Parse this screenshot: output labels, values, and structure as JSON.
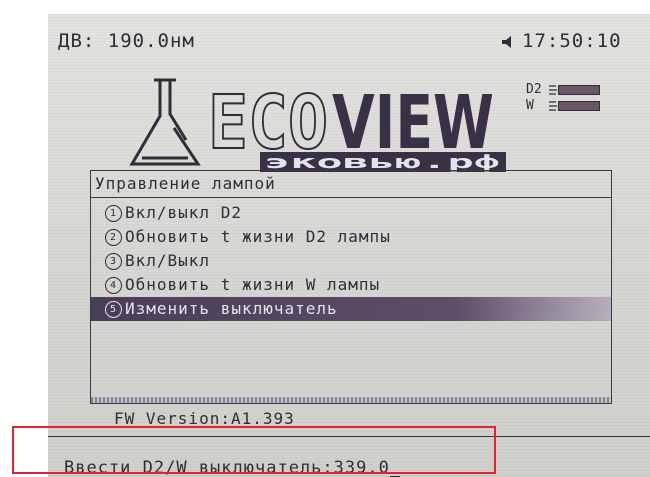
{
  "header": {
    "wavelength": "ДВ: 190.0нм",
    "clock": "17:50:10",
    "speaker_icon": "speaker-icon"
  },
  "logo": {
    "brand_left": "ECO",
    "brand_right": "VIEW",
    "domain": "эковью.рф",
    "icon": "flask-logo-icon"
  },
  "lamps": [
    {
      "label": "D2",
      "level": 1.0
    },
    {
      "label": "W",
      "level": 1.0
    }
  ],
  "menu": {
    "title": "Управление лампой",
    "items": [
      {
        "num": "1",
        "label": "Вкл/выкл D2"
      },
      {
        "num": "2",
        "label": "Обновить t жизни D2 лампы"
      },
      {
        "num": "3",
        "label": "Вкл/Выкл"
      },
      {
        "num": "4",
        "label": "Обновить t жизни W лампы"
      },
      {
        "num": "5",
        "label": "Изменить выключатель"
      }
    ],
    "selected_index": 4
  },
  "footer": {
    "fw_version": "FW Version:A1.393",
    "prompt": "Ввести D2/W выключатель:339.0"
  },
  "colors": {
    "lcd_text": "#2e2e3a",
    "selection": "#4a3f58",
    "annotation": "#e8212c"
  }
}
